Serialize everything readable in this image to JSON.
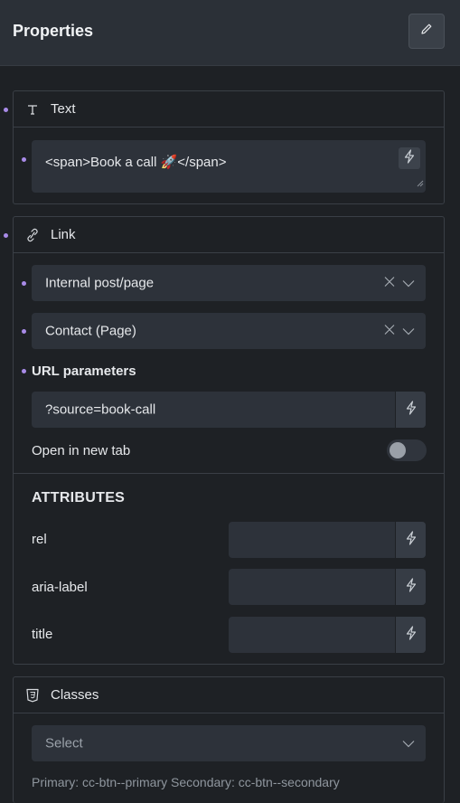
{
  "header": {
    "title": "Properties",
    "edit_icon": "pencil-icon"
  },
  "text_panel": {
    "title": "Text",
    "icon": "text-type-icon",
    "value": "<span>Book a call 🚀</span>"
  },
  "link_panel": {
    "title": "Link",
    "icon": "link-icon",
    "link_type": "Internal post/page",
    "link_target": "Contact (Page)",
    "url_params_label": "URL parameters",
    "url_params_value": "?source=book-call",
    "new_tab_label": "Open in new tab",
    "new_tab_enabled": false,
    "attributes_heading": "ATTRIBUTES",
    "attributes": [
      {
        "label": "rel",
        "value": ""
      },
      {
        "label": "aria-label",
        "value": ""
      },
      {
        "label": "title",
        "value": ""
      }
    ]
  },
  "classes_panel": {
    "title": "Classes",
    "icon": "css-shield-icon",
    "select_placeholder": "Select",
    "hint": "Primary: cc-btn--primary Secondary: cc-btn--secondary"
  },
  "colors": {
    "background": "#1e2125",
    "header": "#2b3037",
    "field": "#2d323a",
    "accent_dot": "#a98be8"
  }
}
